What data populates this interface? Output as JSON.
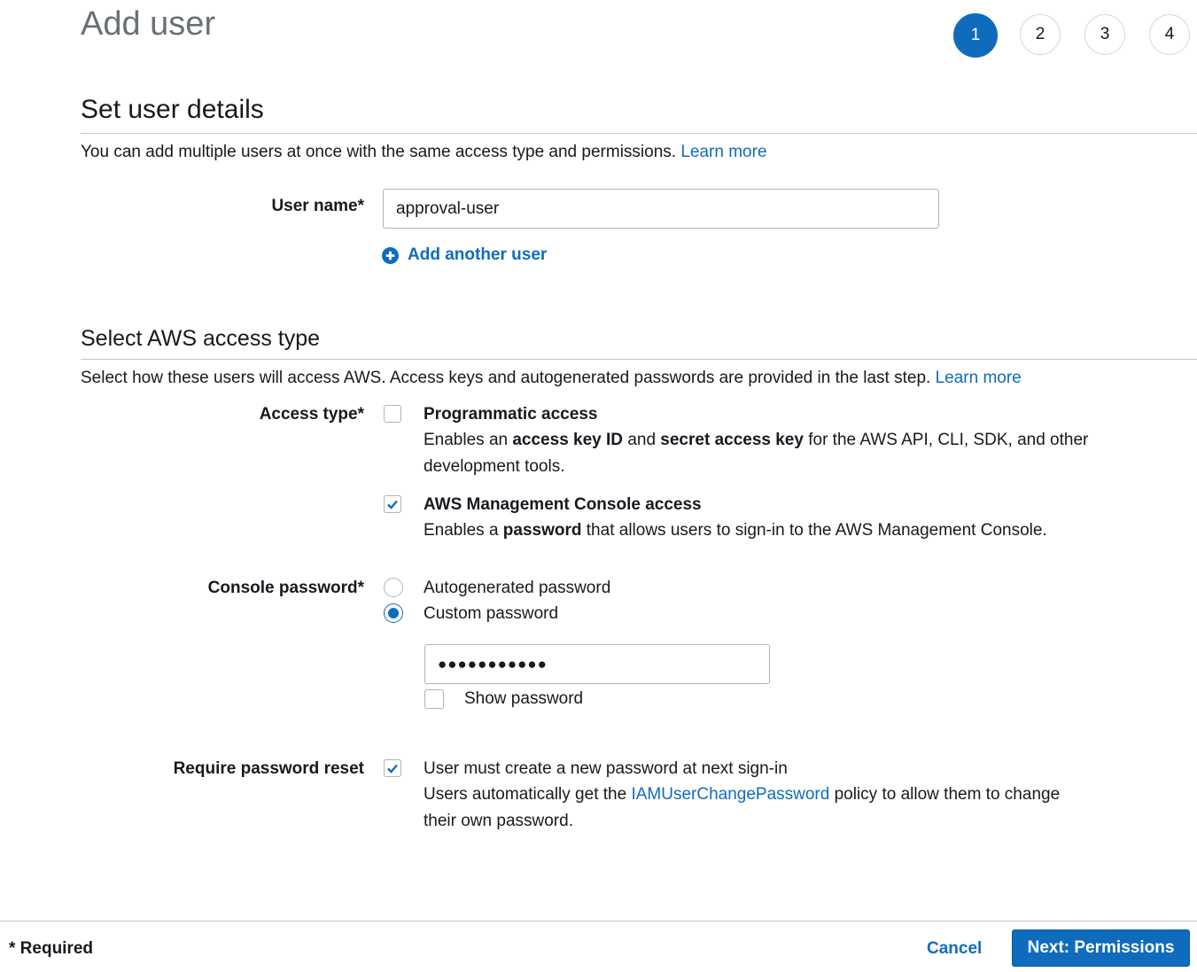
{
  "page": {
    "title": "Add user"
  },
  "steps": [
    {
      "label": "1",
      "active": true
    },
    {
      "label": "2",
      "active": false
    },
    {
      "label": "3",
      "active": false
    },
    {
      "label": "4",
      "active": false
    }
  ],
  "details": {
    "title": "Set user details",
    "description": "You can add multiple users at once with the same access type and permissions.",
    "learn_more": "Learn more",
    "user_name_label": "User name*",
    "user_name_value": "approval-user",
    "add_another": "Add another user"
  },
  "access": {
    "title": "Select AWS access type",
    "description": "Select how these users will access AWS. Access keys and autogenerated passwords are provided in the last step.",
    "learn_more": "Learn more",
    "access_type_label": "Access type*",
    "programmatic": {
      "title": "Programmatic access",
      "text_1": "Enables an",
      "bold_1": "access key ID",
      "text_2": "and",
      "bold_2": "secret access key",
      "text_3": "for the AWS API, CLI, SDK, and other development tools.",
      "checked": false
    },
    "console": {
      "title": "AWS Management Console access",
      "text_1": "Enables a",
      "bold_1": "password",
      "text_2": "that allows users to sign-in to the AWS Management Console.",
      "checked": true
    },
    "console_password_label": "Console password*",
    "autogenerated": "Autogenerated password",
    "custom": "Custom password",
    "selected_option": "custom",
    "password_value": "●●●●●●●●●●●",
    "show_password": "Show password",
    "reset_label": "Require password reset",
    "reset_text": "User must create a new password at next sign-in",
    "reset_desc_1": "Users automatically get the",
    "reset_link": "IAMUserChangePassword",
    "reset_desc_2": "policy to allow them to change their own password.",
    "reset_checked": true
  },
  "footer": {
    "required": "* Required",
    "cancel": "Cancel",
    "next": "Next: Permissions"
  },
  "colors": {
    "accent": "#0f6cbd",
    "text": "#16191f",
    "muted": "#687078",
    "border": "#aab7b8"
  }
}
